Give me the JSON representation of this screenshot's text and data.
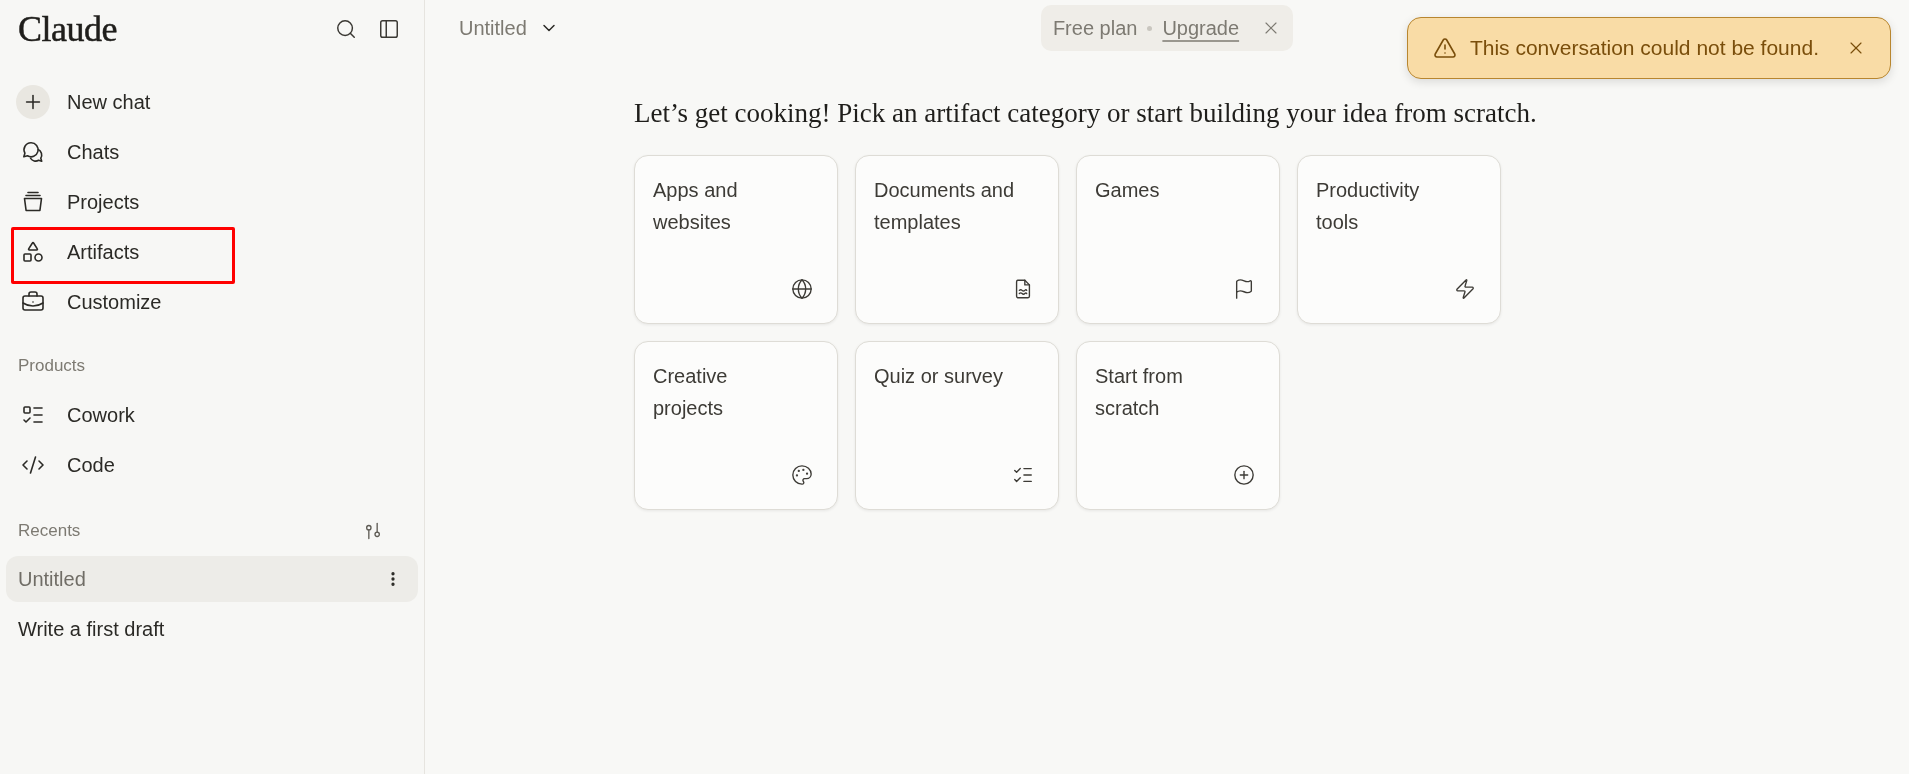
{
  "sidebar": {
    "logo": "Claude",
    "new_chat": "New chat",
    "nav": [
      {
        "label": "Chats",
        "highlighted": false
      },
      {
        "label": "Projects",
        "highlighted": false
      },
      {
        "label": "Artifacts",
        "highlighted": true
      },
      {
        "label": "Customize",
        "highlighted": false
      }
    ],
    "products": {
      "title": "Products",
      "items": [
        {
          "label": "Cowork"
        },
        {
          "label": "Code"
        }
      ]
    },
    "recents": {
      "title": "Recents",
      "items": [
        {
          "label": "Untitled",
          "selected": true
        },
        {
          "label": "Write a first draft",
          "selected": false
        }
      ]
    }
  },
  "header": {
    "title": "Untitled",
    "plan_banner": {
      "plan": "Free plan",
      "link": "Upgrade"
    }
  },
  "toast": {
    "message": "This conversation could not be found."
  },
  "main": {
    "heading": "Let’s get cooking! Pick an artifact category or start building your idea from scratch.",
    "cards": [
      {
        "label": "Apps and websites"
      },
      {
        "label": "Documents and templates"
      },
      {
        "label": "Games"
      },
      {
        "label": "Productivity tools"
      },
      {
        "label": "Creative projects"
      },
      {
        "label": "Quiz or survey"
      },
      {
        "label": "Start from scratch"
      }
    ]
  }
}
